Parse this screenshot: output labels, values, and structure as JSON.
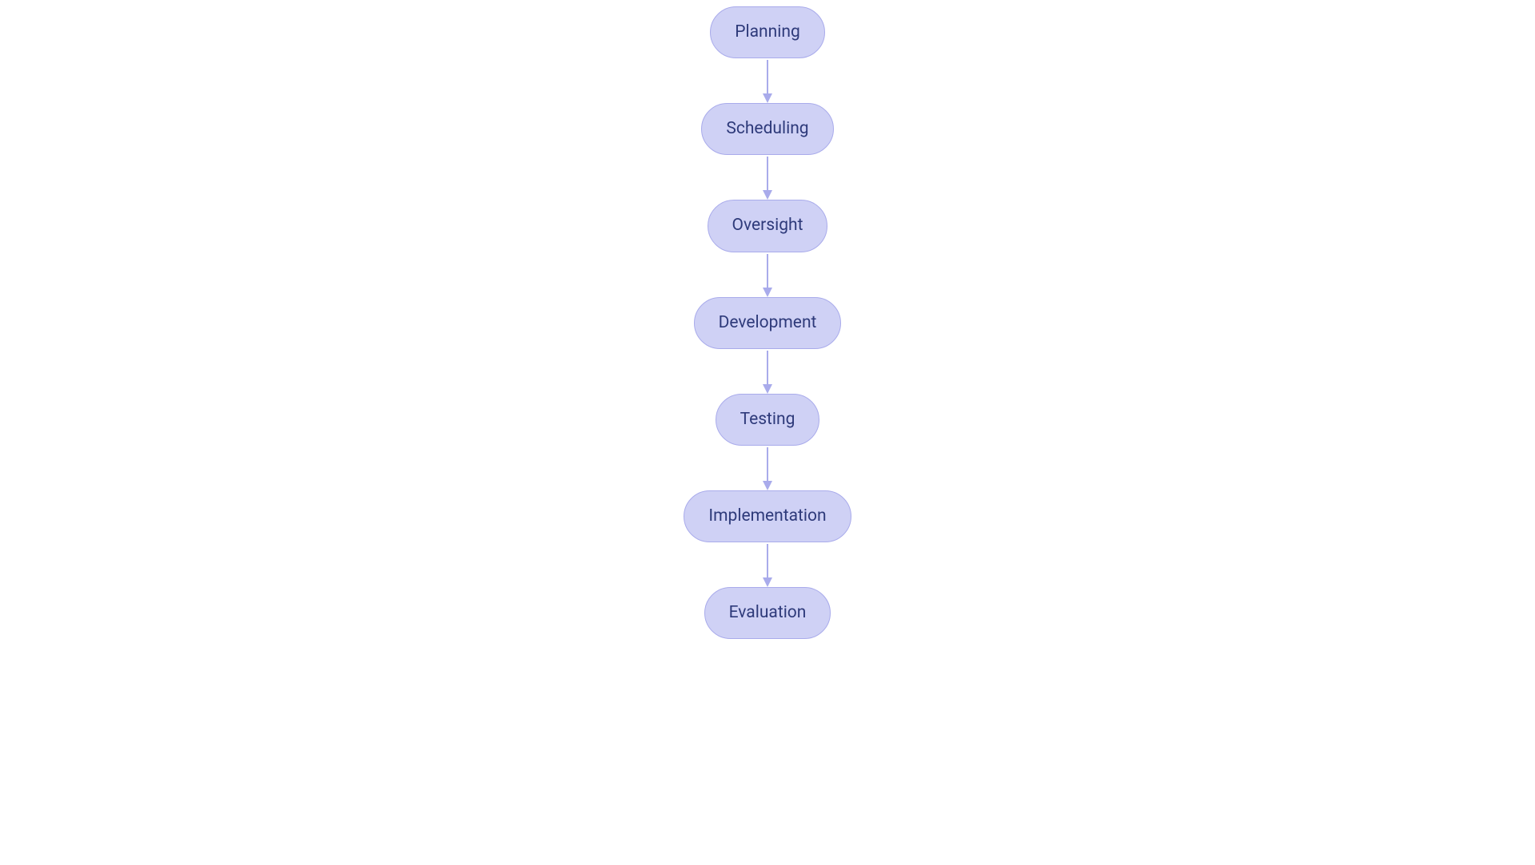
{
  "diagram": {
    "type": "flowchart-vertical",
    "nodes": [
      {
        "label": "Planning"
      },
      {
        "label": "Scheduling"
      },
      {
        "label": "Oversight"
      },
      {
        "label": "Development"
      },
      {
        "label": "Testing"
      },
      {
        "label": "Implementation"
      },
      {
        "label": "Evaluation"
      }
    ],
    "colors": {
      "node_fill": "#cfd1f5",
      "node_border": "#a9abeb",
      "text": "#2e3a7a",
      "arrow": "#a9abeb"
    }
  }
}
